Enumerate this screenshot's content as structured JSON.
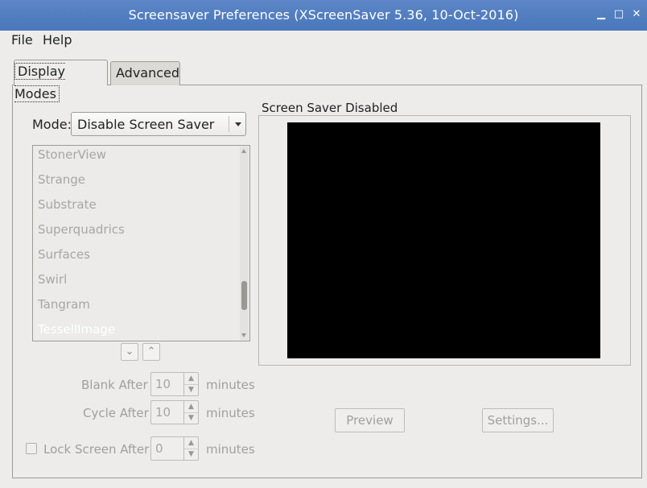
{
  "window": {
    "title": "Screensaver Preferences  (XScreenSaver 5.36, 10-Oct-2016)",
    "minimize_glyph": "▁",
    "maximize_glyph": "□",
    "close_glyph": "✕"
  },
  "menubar": {
    "items": [
      {
        "label": "File"
      },
      {
        "label": "Help"
      }
    ]
  },
  "tabs": [
    {
      "label": "Display Modes",
      "active": true
    },
    {
      "label": "Advanced",
      "active": false
    }
  ],
  "mode": {
    "label": "Mode:",
    "selected": "Disable Screen Saver"
  },
  "screensaver_list": {
    "items": [
      "StonerView",
      "Strange",
      "Substrate",
      "Superquadrics",
      "Surfaces",
      "Swirl",
      "Tangram",
      "TessellImage"
    ],
    "selected_index": 7
  },
  "list_nav": {
    "down_glyph": "⌄",
    "up_glyph": "⌃"
  },
  "blank_after": {
    "label": "Blank After",
    "value": "10",
    "unit": "minutes"
  },
  "cycle_after": {
    "label": "Cycle After",
    "value": "10",
    "unit": "minutes"
  },
  "lock_screen": {
    "label": "Lock Screen After",
    "value": "0",
    "unit": "minutes",
    "checked": false
  },
  "preview_frame": {
    "label": "Screen Saver Disabled"
  },
  "buttons": {
    "preview": "Preview",
    "settings": "Settings..."
  },
  "colors": {
    "titlebar": "#4a78bd",
    "window_bg": "#edeceb",
    "preview_bg": "#000000"
  }
}
